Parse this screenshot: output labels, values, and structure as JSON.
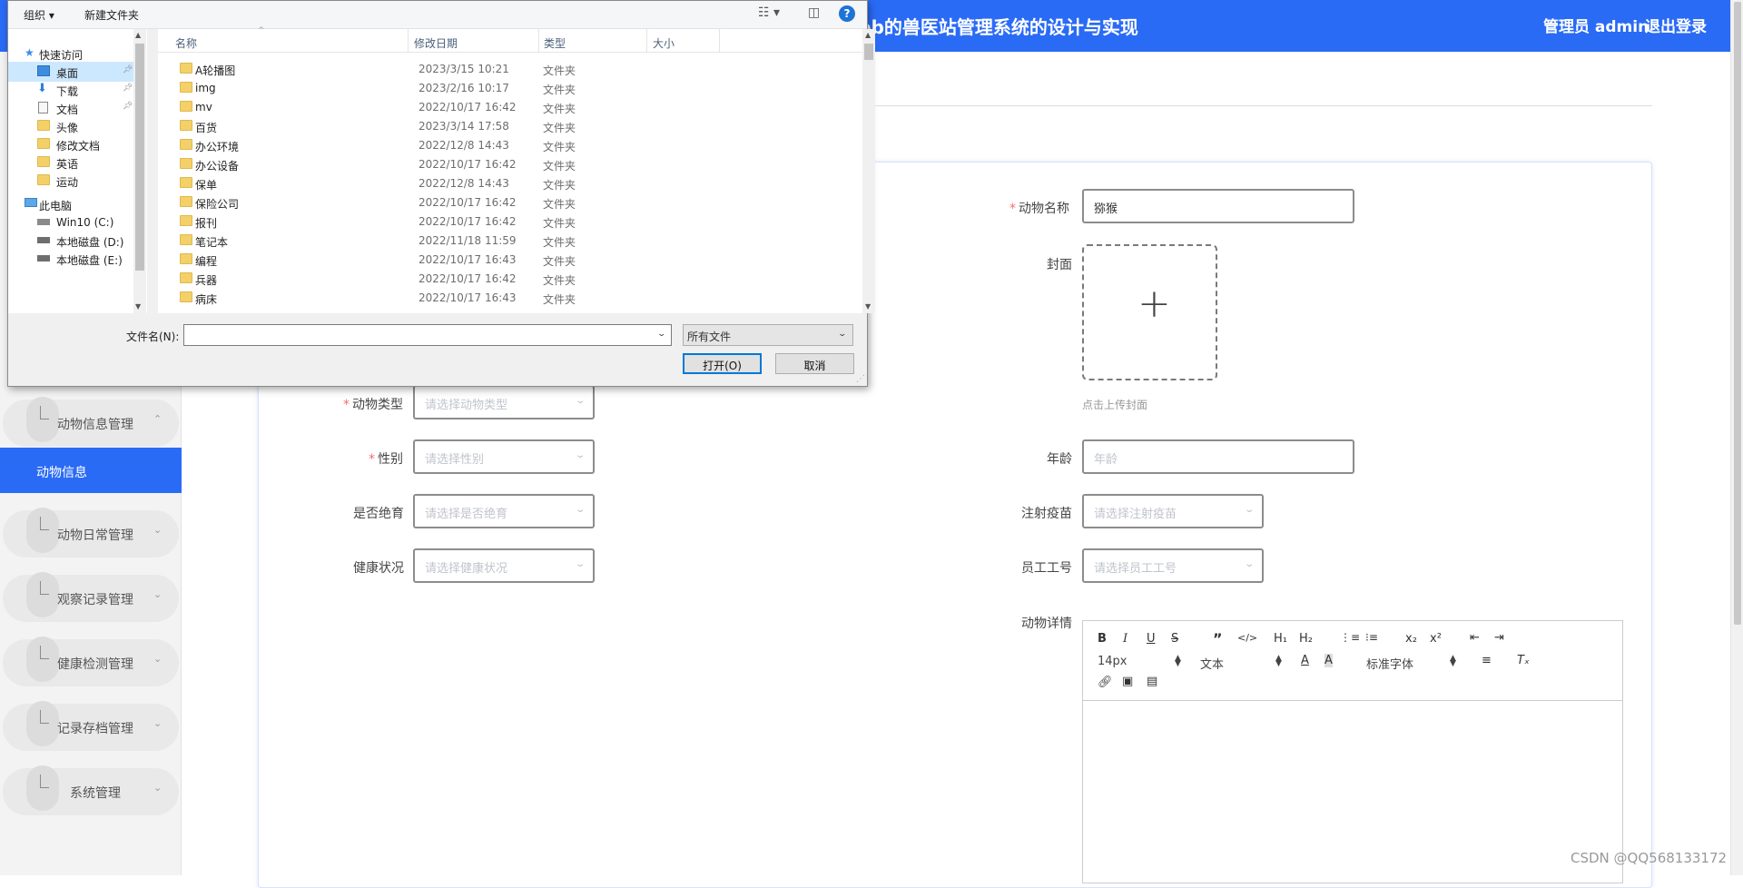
{
  "header": {
    "title": "eb的兽医站管理系统的设计与实现",
    "admin": "管理员 admin",
    "logout": "退出登录"
  },
  "sidebar": {
    "items": [
      {
        "label": "动物信息管理",
        "chevron": "⌃",
        "expanded": true
      },
      {
        "label": "动物日常管理",
        "chevron": "⌄"
      },
      {
        "label": "观察记录管理",
        "chevron": "⌄"
      },
      {
        "label": "健康检测管理",
        "chevron": "⌄"
      },
      {
        "label": "记录存档管理",
        "chevron": "⌄"
      },
      {
        "label": "系统管理",
        "chevron": "⌄"
      }
    ],
    "active_item": "动物信息"
  },
  "form": {
    "animal_name_label": "动物名称",
    "animal_name_value": "猕猴",
    "cover_label": "封面",
    "cover_hint": "点击上传封面",
    "animal_type_label": "动物类型",
    "animal_type_placeholder": "请选择动物类型",
    "gender_label": "性别",
    "gender_placeholder": "请选择性别",
    "sterilized_label": "是否绝育",
    "sterilized_placeholder": "请选择是否绝育",
    "health_label": "健康状况",
    "health_placeholder": "请选择健康状况",
    "age_label": "年龄",
    "age_placeholder": "年龄",
    "vaccine_label": "注射疫苗",
    "vaccine_placeholder": "请选择注射疫苗",
    "employee_label": "员工工号",
    "employee_placeholder": "请选择员工工号",
    "details_label": "动物详情",
    "required_mark": "*"
  },
  "editor": {
    "font_size": "14px",
    "block_type": "文本",
    "font_family": "标准字体"
  },
  "watermark": "CSDN @QQ568133172",
  "dialog": {
    "toolbar": {
      "organize": "组织 ▾",
      "new_folder": "新建文件夹"
    },
    "nav": {
      "quick_access": "快速访问",
      "items": [
        "桌面",
        "下载",
        "文档",
        "头像",
        "修改文档",
        "英语",
        "运动"
      ],
      "this_pc": "此电脑",
      "drives": [
        "Win10 (C:)",
        "本地磁盘 (D:)",
        "本地磁盘 (E:)"
      ]
    },
    "columns": {
      "name": "名称",
      "modified": "修改日期",
      "type": "类型",
      "size": "大小"
    },
    "files": [
      {
        "name": "A轮播图",
        "date": "2023/3/15 10:21",
        "type": "文件夹"
      },
      {
        "name": "img",
        "date": "2023/2/16 10:17",
        "type": "文件夹"
      },
      {
        "name": "mv",
        "date": "2022/10/17 16:42",
        "type": "文件夹"
      },
      {
        "name": "百货",
        "date": "2023/3/14 17:58",
        "type": "文件夹"
      },
      {
        "name": "办公环境",
        "date": "2022/12/8 14:43",
        "type": "文件夹"
      },
      {
        "name": "办公设备",
        "date": "2022/10/17 16:42",
        "type": "文件夹"
      },
      {
        "name": "保单",
        "date": "2022/12/8 14:43",
        "type": "文件夹"
      },
      {
        "name": "保险公司",
        "date": "2022/10/17 16:42",
        "type": "文件夹"
      },
      {
        "name": "报刊",
        "date": "2022/10/17 16:42",
        "type": "文件夹"
      },
      {
        "name": "笔记本",
        "date": "2022/11/18 11:59",
        "type": "文件夹"
      },
      {
        "name": "编程",
        "date": "2022/10/17 16:43",
        "type": "文件夹"
      },
      {
        "name": "兵器",
        "date": "2022/10/17 16:42",
        "type": "文件夹"
      },
      {
        "name": "病床",
        "date": "2022/10/17 16:43",
        "type": "文件夹"
      }
    ],
    "filename_label": "文件名(N):",
    "filename_value": "",
    "filetype_value": "所有文件",
    "open_button": "打开(O)",
    "cancel_button": "取消"
  },
  "colors": {
    "primary": "#2a6bf5",
    "required": "#f56c6c",
    "selected_row": "#cce8ff"
  }
}
